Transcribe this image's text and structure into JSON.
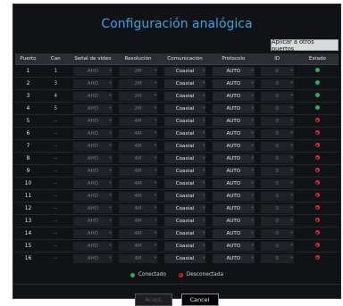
{
  "title": "Configuración analógica",
  "apply_label": "Aplicar a otros puertos",
  "headers": [
    "Puerto",
    "Can",
    "Señal de video",
    "Resolución",
    "Comunicación",
    "Protocolo",
    "ID",
    "Estado"
  ],
  "rows": [
    {
      "port": "1",
      "can": "1",
      "signal": "AHD",
      "res": "2M",
      "comm": "Coaxial",
      "proto": "AUTO",
      "id": "0",
      "status": "connected"
    },
    {
      "port": "2",
      "can": "3",
      "signal": "AHD",
      "res": "2M",
      "comm": "Coaxial",
      "proto": "AUTO",
      "id": "0",
      "status": "connected"
    },
    {
      "port": "3",
      "can": "4",
      "signal": "AHD",
      "res": "2M",
      "comm": "Coaxial",
      "proto": "AUTO",
      "id": "0",
      "status": "connected"
    },
    {
      "port": "4",
      "can": "5",
      "signal": "AHD",
      "res": "2M",
      "comm": "Coaxial",
      "proto": "AUTO",
      "id": "0",
      "status": "connected"
    },
    {
      "port": "5",
      "can": "--",
      "signal": "AHD",
      "res": "4M",
      "comm": "Coaxial",
      "proto": "AUTO",
      "id": "0",
      "status": "disconnected"
    },
    {
      "port": "6",
      "can": "--",
      "signal": "AHD",
      "res": "4M",
      "comm": "Coaxial",
      "proto": "AUTO",
      "id": "0",
      "status": "disconnected"
    },
    {
      "port": "7",
      "can": "--",
      "signal": "AHD",
      "res": "4M",
      "comm": "Coaxial",
      "proto": "AUTO",
      "id": "0",
      "status": "disconnected"
    },
    {
      "port": "8",
      "can": "--",
      "signal": "AHD",
      "res": "4M",
      "comm": "Coaxial",
      "proto": "AUTO",
      "id": "0",
      "status": "disconnected"
    },
    {
      "port": "9",
      "can": "--",
      "signal": "AHD",
      "res": "4M",
      "comm": "Coaxial",
      "proto": "AUTO",
      "id": "0",
      "status": "disconnected"
    },
    {
      "port": "10",
      "can": "--",
      "signal": "AHD",
      "res": "4M",
      "comm": "Coaxial",
      "proto": "AUTO",
      "id": "0",
      "status": "disconnected"
    },
    {
      "port": "11",
      "can": "--",
      "signal": "AHD",
      "res": "4M",
      "comm": "Coaxial",
      "proto": "AUTO",
      "id": "0",
      "status": "disconnected"
    },
    {
      "port": "12",
      "can": "--",
      "signal": "AHD",
      "res": "4M",
      "comm": "Coaxial",
      "proto": "AUTO",
      "id": "0",
      "status": "disconnected"
    },
    {
      "port": "13",
      "can": "--",
      "signal": "AHD",
      "res": "4M",
      "comm": "Coaxial",
      "proto": "AUTO",
      "id": "0",
      "status": "disconnected"
    },
    {
      "port": "14",
      "can": "--",
      "signal": "AHD",
      "res": "4M",
      "comm": "Coaxial",
      "proto": "AUTO",
      "id": "0",
      "status": "disconnected"
    },
    {
      "port": "15",
      "can": "--",
      "signal": "AHD",
      "res": "4M",
      "comm": "Coaxial",
      "proto": "AUTO",
      "id": "0",
      "status": "disconnected"
    },
    {
      "port": "16",
      "can": "--",
      "signal": "AHD",
      "res": "4M",
      "comm": "Coaxial",
      "proto": "AUTO",
      "id": "0",
      "status": "disconnected"
    }
  ],
  "legend": {
    "connected": "Conectado",
    "disconnected": "Desconectada"
  },
  "buttons": {
    "accept": "Acept.",
    "cancel": "Cancel"
  },
  "colors": {
    "title": "#3aa3e3",
    "connected": "#26b24b",
    "disconnected": "#e02a2a",
    "panel": "#101215"
  }
}
